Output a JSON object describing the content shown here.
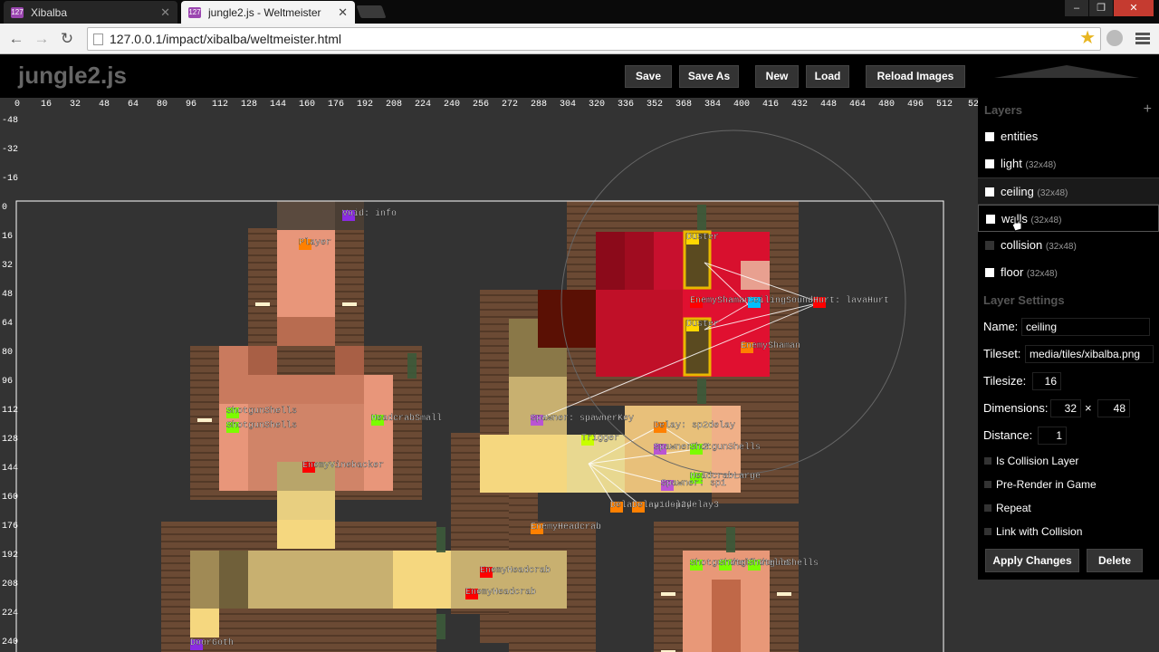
{
  "browser": {
    "tabs": [
      {
        "label": "Xibalba",
        "favicon": "127"
      },
      {
        "label": "jungle2.js - Weltmeister",
        "favicon": "127"
      }
    ],
    "url": "127.0.0.1/impact/xibalba/weltmeister.html"
  },
  "header": {
    "title": "jungle2.js",
    "buttons": {
      "save": "Save",
      "save_as": "Save As",
      "new": "New",
      "load": "Load",
      "reload": "Reload Images"
    }
  },
  "ruler": {
    "x_labels": [
      "0",
      "16",
      "32",
      "48",
      "64",
      "80",
      "96",
      "112",
      "128",
      "144",
      "160",
      "176",
      "192",
      "208",
      "224",
      "240",
      "256",
      "272",
      "288",
      "304",
      "320",
      "336",
      "352",
      "368",
      "384",
      "400",
      "416",
      "432",
      "448",
      "464",
      "480",
      "496",
      "512",
      "52"
    ],
    "y_labels": [
      "-48",
      "-32",
      "-16",
      "0",
      "16",
      "32",
      "48",
      "64",
      "80",
      "96",
      "112",
      "128",
      "144",
      "160",
      "176",
      "192",
      "208",
      "224",
      "240"
    ]
  },
  "entities": [
    {
      "label": "Void: info",
      "color": "#8a2be2"
    },
    {
      "label": "Player",
      "color": "#ff8000"
    },
    {
      "label": "ShotgunShells",
      "color": "#7cfc00"
    },
    {
      "label": "ShotgunShells",
      "color": "#7cfc00"
    },
    {
      "label": "HeadcrabSmall",
      "color": "#7cfc00"
    },
    {
      "label": "EnemyVinebacker",
      "color": "#ff0000"
    },
    {
      "label": "Spawner: spawnerKey",
      "color": "#ba55d3"
    },
    {
      "label": "Trigger",
      "color": "#c8ff00"
    },
    {
      "label": "Delay: sp2delay",
      "color": "#ff8000"
    },
    {
      "label": "SpawnerSp2",
      "color": "#ba55d3"
    },
    {
      "label": "ShotgunShells",
      "color": "#7cfc00"
    },
    {
      "label": "HeadcrabLarge",
      "color": "#7cfc00"
    },
    {
      "label": "Spawner: sp1",
      "color": "#ba55d3"
    },
    {
      "label": "Delay: sp1delay",
      "color": "#ff8000"
    },
    {
      "label": "Delay: sp2delay3",
      "color": "#ff8000"
    },
    {
      "label": "EnemyHeadcrab",
      "color": "#ff8000"
    },
    {
      "label": "EnemyHeadcrab",
      "color": "#ff0000"
    },
    {
      "label": "EnemyHeadcrab",
      "color": "#ff0000"
    },
    {
      "label": "DoorGoth",
      "color": "#8a2be2"
    },
    {
      "label": "Duster",
      "color": "#ffd700"
    },
    {
      "label": "Duster",
      "color": "#ffd700"
    },
    {
      "label": "EnemyShaman",
      "color": "#ff0000"
    },
    {
      "label": "CeilingSound",
      "color": "#00bfff"
    },
    {
      "label": "EnemyShaman",
      "color": "#ff8000"
    },
    {
      "label": "Hurt: lavaHurt",
      "color": "#ff0000"
    },
    {
      "label": "ShotgunShells",
      "color": "#7cfc00"
    },
    {
      "label": "ShotgunShells",
      "color": "#7cfc00"
    },
    {
      "label": "ShotgunShells",
      "color": "#7cfc00"
    }
  ],
  "panel": {
    "layers_title": "Layers",
    "add_icon": "+",
    "layers": [
      {
        "name": "entities",
        "dim": ""
      },
      {
        "name": "light",
        "dim": "(32x48)"
      },
      {
        "name": "ceiling",
        "dim": "(32x48)"
      },
      {
        "name": "walls",
        "dim": "(32x48)"
      },
      {
        "name": "collision",
        "dim": "(32x48)"
      },
      {
        "name": "floor",
        "dim": "(32x48)"
      }
    ],
    "settings_title": "Layer Settings",
    "name_label": "Name:",
    "name_value": "ceiling",
    "tileset_label": "Tileset:",
    "tileset_value": "media/tiles/xibalba.png",
    "tilesize_label": "Tilesize:",
    "tilesize_value": "16",
    "dimensions_label": "Dimensions:",
    "dim_w": "32",
    "dim_x": "×",
    "dim_h": "48",
    "distance_label": "Distance:",
    "distance_value": "1",
    "checkboxes": [
      "Is Collision Layer",
      "Pre-Render in Game",
      "Repeat",
      "Link with Collision"
    ],
    "apply": "Apply Changes",
    "delete": "Delete"
  },
  "colors": {
    "canvas": "#333333",
    "dirt": "#6b4a34",
    "light_pink": "#e8967a",
    "light_yellow": "#f5d77f",
    "lava": "#c8102e"
  }
}
